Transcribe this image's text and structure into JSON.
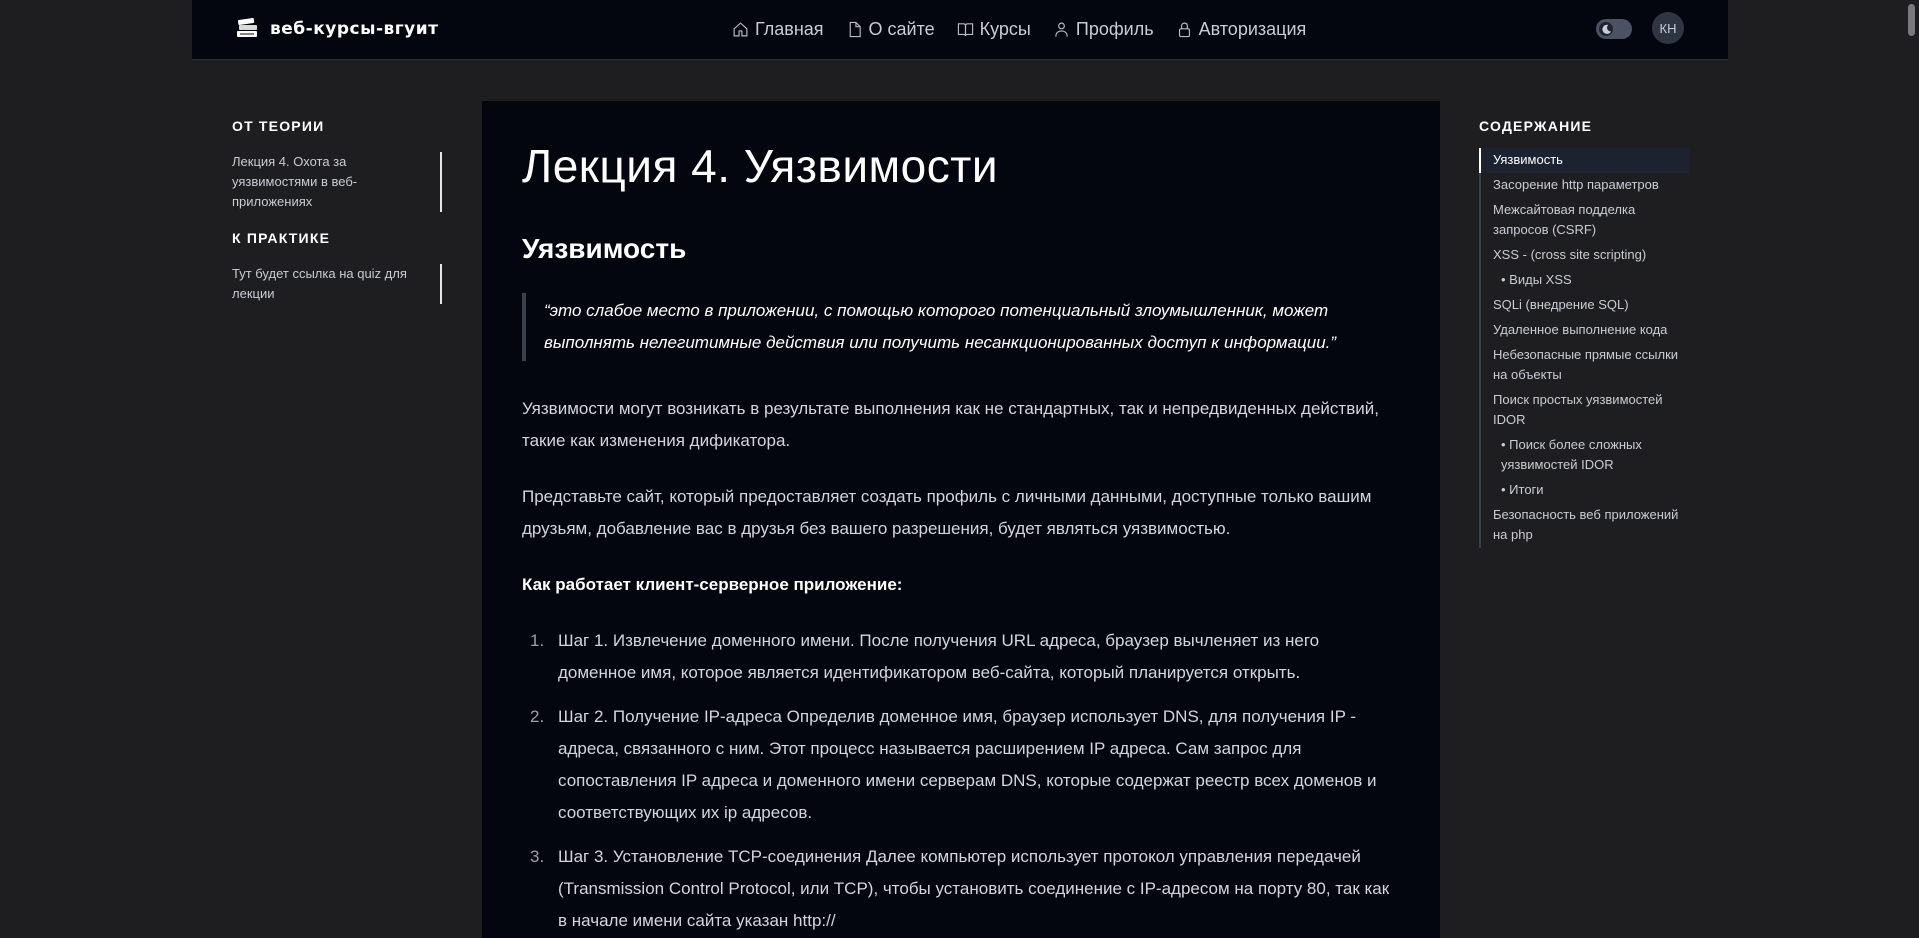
{
  "header": {
    "brand": "веб-курсы-вгуит",
    "nav": [
      {
        "label": "Главная",
        "icon": "home-icon"
      },
      {
        "label": "О сайте",
        "icon": "document-icon"
      },
      {
        "label": "Курсы",
        "icon": "book-icon"
      },
      {
        "label": "Профиль",
        "icon": "user-icon"
      },
      {
        "label": "Авторизация",
        "icon": "lock-icon"
      }
    ],
    "avatar_initials": "КН"
  },
  "left": {
    "theory_heading": "От теории",
    "theory_link": "Лекция 4. Охота за уязвимостями в веб-приложениях",
    "practice_heading": "К практике",
    "practice_link": "Тут будет ссылка на quiz для лекции"
  },
  "article": {
    "title": "Лекция 4. Уязвимости",
    "section_title": "Уязвимость",
    "quote": "“это слабое место в приложении, с помощью которого потенциальный злоумышленник, может выполнять нелегитимные действия или получить несанкционированных доступ к информации.”",
    "para1": "Уязвимости могут возникать в результате выполнения как не стандартных, так и непредвиденных действий, такие как изменения дификатора.",
    "para2": "Представьте сайт, который предоставляет создать профиль с личными данными, доступные только вашим друзьям, добавление вас в друзья без вашего разрешения, будет являться уязвимостью.",
    "subheading": "Как работает клиент-серверное приложение:",
    "steps": [
      {
        "num": "1.",
        "text": "Шаг 1. Извлечение доменного имени. После получения URL адреса, браузер вычленяет из него доменное имя, которое является идентификатором веб-сайта, который планируется открыть."
      },
      {
        "num": "2.",
        "text": "Шаг 2. Получение IP-адреса Определив доменное имя, браузер использует DNS, для получения IP - адреса, связанного с ним. Этот процесс называется расширением IP адреса. Сам запрос для сопоставления IP адреса и доменного имени серверам DNS, которые содержат реестр всех доменов и соответствующих их ip адресов."
      },
      {
        "num": "3.",
        "text": "Шаг 3. Установление TCP-соединения Далее компьютер использует протокол управления передачей (Transmission Control Protocol, или TCP), чтобы установить соединение с IP-адресом на порту 80, так как в начале имени сайта указан http://"
      }
    ]
  },
  "toc": {
    "heading": "Содержание",
    "items": [
      {
        "label": "Уязвимость",
        "active": true,
        "sub": false
      },
      {
        "label": "Засорение http параметров",
        "active": false,
        "sub": false
      },
      {
        "label": "Межсайтовая подделка запросов (CSRF)",
        "active": false,
        "sub": false
      },
      {
        "label": "XSS - (cross site scripting)",
        "active": false,
        "sub": false
      },
      {
        "label": "Виды XSS",
        "active": false,
        "sub": true
      },
      {
        "label": "SQLi (внедрение SQL)",
        "active": false,
        "sub": false
      },
      {
        "label": "Удаленное выполнение кода",
        "active": false,
        "sub": false
      },
      {
        "label": "Небезопасные прямые ссылки на объекты",
        "active": false,
        "sub": false
      },
      {
        "label": "Поиск простых уязвимостей IDOR",
        "active": false,
        "sub": false
      },
      {
        "label": "Поиск более сложных уязвимостей IDOR",
        "active": false,
        "sub": true
      },
      {
        "label": "Итоги",
        "active": false,
        "sub": true
      },
      {
        "label": "Безопасность веб приложений на php",
        "active": false,
        "sub": false
      }
    ]
  }
}
